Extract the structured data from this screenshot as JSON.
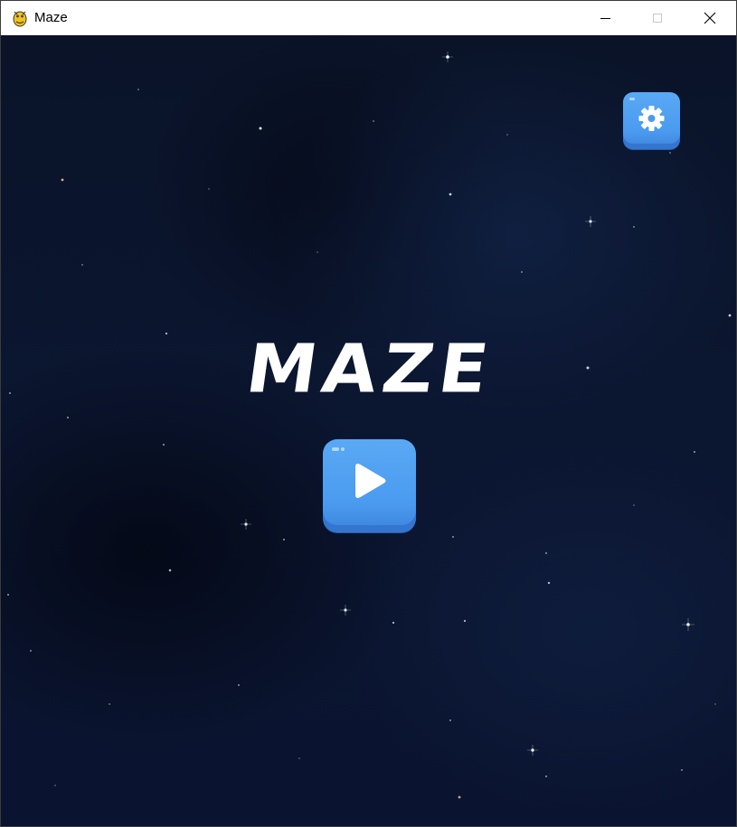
{
  "window": {
    "title": "Maze",
    "controls": {
      "minimize": "minimize",
      "maximize": "maximize",
      "close": "close"
    }
  },
  "game": {
    "logo_text": "MAZE",
    "play_icon": "play-icon",
    "settings_icon": "gear-icon"
  },
  "colors": {
    "background": "#0b1631",
    "button": "#4a9af0",
    "button_shadow": "#3476cf",
    "logo": "#ffffff"
  }
}
